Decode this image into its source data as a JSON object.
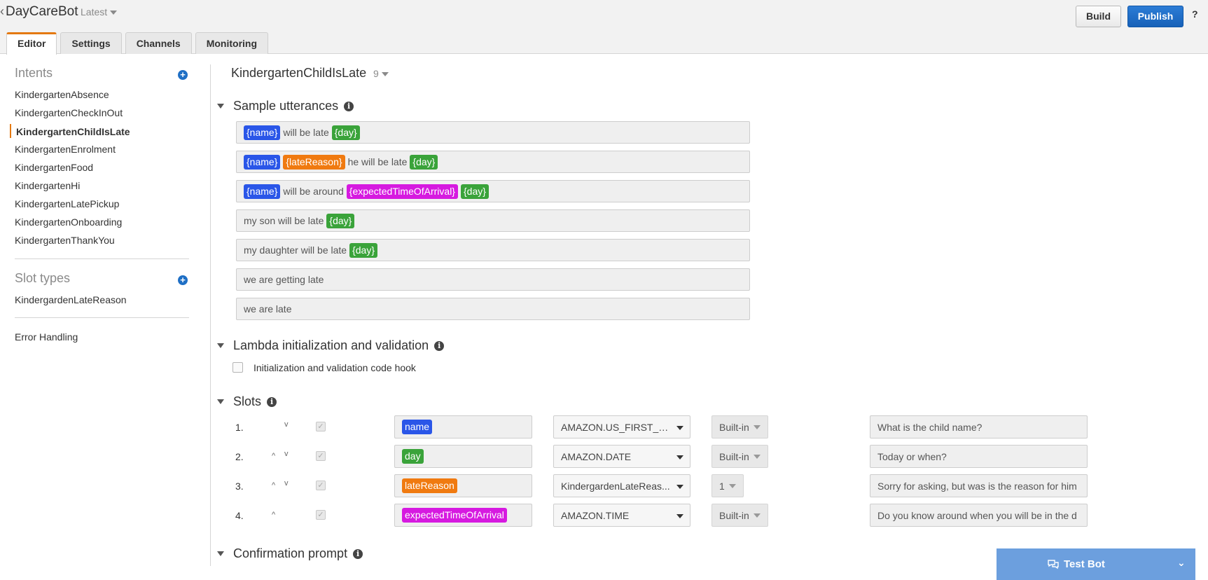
{
  "header": {
    "back_glyph": "‹",
    "title": "DayCareBot",
    "version": "Latest",
    "build_label": "Build",
    "publish_label": "Publish",
    "help_label": "?"
  },
  "tabs": [
    {
      "label": "Editor",
      "active": true
    },
    {
      "label": "Settings",
      "active": false
    },
    {
      "label": "Channels",
      "active": false
    },
    {
      "label": "Monitoring",
      "active": false
    }
  ],
  "sidebar": {
    "intents_heading": "Intents",
    "intents": [
      "KindergartenAbsence",
      "KindergartenCheckInOut",
      "KindergartenChildIsLate",
      "KindergartenEnrolment",
      "KindergartenFood",
      "KindergartenHi",
      "KindergartenLatePickup",
      "KindergartenOnboarding",
      "KindergartenThankYou"
    ],
    "active_intent_index": 2,
    "slot_types_heading": "Slot types",
    "slot_types": [
      "KindergardenLateReason"
    ],
    "error_handling": "Error Handling",
    "add_glyph": "+"
  },
  "intent": {
    "name": "KindergartenChildIsLate",
    "version": "9"
  },
  "sections": {
    "sample_utterances": "Sample utterances",
    "lambda": "Lambda initialization and validation",
    "lambda_checkbox_label": "Initialization and validation code hook",
    "slots": "Slots",
    "confirmation": "Confirmation prompt",
    "info_glyph": "i"
  },
  "utterances": [
    [
      {
        "t": "{name}",
        "c": "blue"
      },
      {
        "t": "will be late"
      },
      {
        "t": "{day}",
        "c": "green"
      }
    ],
    [
      {
        "t": "{name}",
        "c": "blue"
      },
      {
        "t": "{lateReason}",
        "c": "orange"
      },
      {
        "t": "he will be late"
      },
      {
        "t": "{day}",
        "c": "green"
      }
    ],
    [
      {
        "t": "{name}",
        "c": "blue"
      },
      {
        "t": "will be around"
      },
      {
        "t": "{expectedTimeOfArrival}",
        "c": "magenta"
      },
      {
        "t": "{day}",
        "c": "green"
      }
    ],
    [
      {
        "t": "my son will be late"
      },
      {
        "t": "{day}",
        "c": "green"
      }
    ],
    [
      {
        "t": "my daughter will be late"
      },
      {
        "t": "{day}",
        "c": "green"
      }
    ],
    [
      {
        "t": "we are getting late"
      }
    ],
    [
      {
        "t": "we are late"
      }
    ]
  ],
  "slots": [
    {
      "num": "1.",
      "up": false,
      "down": true,
      "name": "name",
      "color": "blue",
      "type": "AMAZON.US_FIRST_N...",
      "version": "Built-in",
      "prompt": "What is the child name?"
    },
    {
      "num": "2.",
      "up": true,
      "down": true,
      "name": "day",
      "color": "green",
      "type": "AMAZON.DATE",
      "version": "Built-in",
      "prompt": "Today or when?"
    },
    {
      "num": "3.",
      "up": true,
      "down": true,
      "name": "lateReason",
      "color": "orange",
      "type": "KindergardenLateReas...",
      "version": "1",
      "prompt": "Sorry for asking, but was is the reason for him"
    },
    {
      "num": "4.",
      "up": true,
      "down": false,
      "name": "expectedTimeOfArrival",
      "color": "magenta",
      "type": "AMAZON.TIME",
      "version": "Built-in",
      "prompt": "Do you know around when you will be in the d"
    }
  ],
  "test_bot": {
    "label": "Test Bot",
    "chevron": "⌄"
  },
  "glyphs": {
    "up": "^",
    "down": "v",
    "check": "✓"
  },
  "colors": {
    "accent": "#e47911",
    "publish": "#1f6fc5",
    "chip_blue": "#2a56e8",
    "chip_orange": "#f07a10",
    "chip_green": "#3aa33a",
    "chip_magenta": "#d61ae0"
  }
}
